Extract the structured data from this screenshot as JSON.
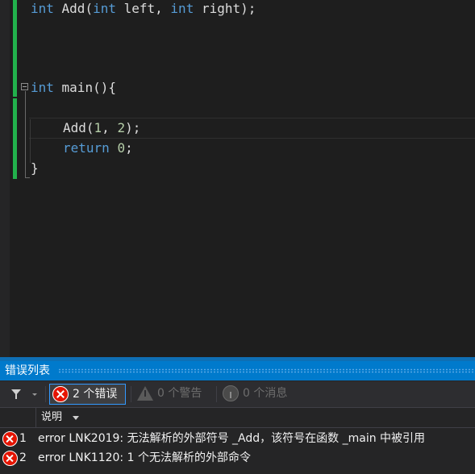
{
  "editor": {
    "lines": {
      "decl": {
        "kw1": "int",
        "name": " Add(",
        "kw2": "int",
        "p1": " left, ",
        "kw3": "int",
        "p2": " right);"
      },
      "main": {
        "kw": "int",
        "rest": " main(){"
      },
      "call": {
        "text": "Add(",
        "n1": "1",
        "sep": ", ",
        "n2": "2",
        "end": ");"
      },
      "ret": {
        "kw": "return",
        "sp": " ",
        "n": "0",
        "end": ";"
      },
      "close": "}"
    },
    "colors": {
      "keyword": "#569cd6",
      "number": "#b5cea8",
      "text": "#dcdcdc",
      "change_bar": "#22b14c"
    }
  },
  "error_list": {
    "title": "错误列表",
    "toolbar": {
      "errors_label": "2 个错误",
      "warnings_label": "0 个警告",
      "messages_label": "0 个消息"
    },
    "column_header": "说明",
    "rows": [
      {
        "num": "1",
        "text": "error LNK2019: 无法解析的外部符号 _Add，该符号在函数 _main 中被引用"
      },
      {
        "num": "2",
        "text": "error LNK1120: 1 个无法解析的外部命令"
      }
    ],
    "colors": {
      "title_bar": "#007acc",
      "error_icon": "#e51400",
      "selected_border": "#3399ff"
    }
  }
}
